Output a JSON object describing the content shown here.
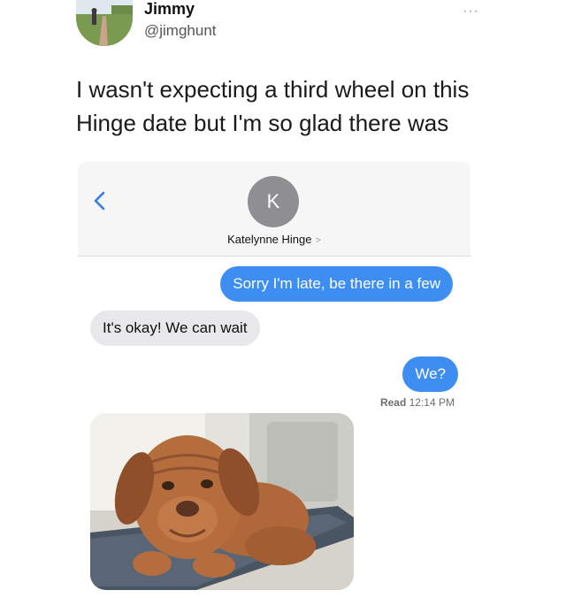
{
  "tweet": {
    "author_name": "Jimmy",
    "author_handle": "@jimghunt",
    "more_label": "···",
    "text": "I wasn't expecting a third wheel on this Hinge date but I'm so glad there was"
  },
  "imessage": {
    "contact_initial": "K",
    "contact_name": "Katelynne Hinge",
    "contact_chevron": ">",
    "messages": [
      {
        "direction": "sent",
        "text": "Sorry I'm late, be there in a few"
      },
      {
        "direction": "received",
        "text": "It's okay! We can wait"
      },
      {
        "direction": "sent",
        "text": "We?"
      }
    ],
    "read_label": "Read",
    "read_time": "12:14 PM",
    "sent_color": "#3d8ef0",
    "received_color": "#e8e8ea"
  },
  "icons": [
    "back-chevron-icon",
    "more-icon"
  ]
}
